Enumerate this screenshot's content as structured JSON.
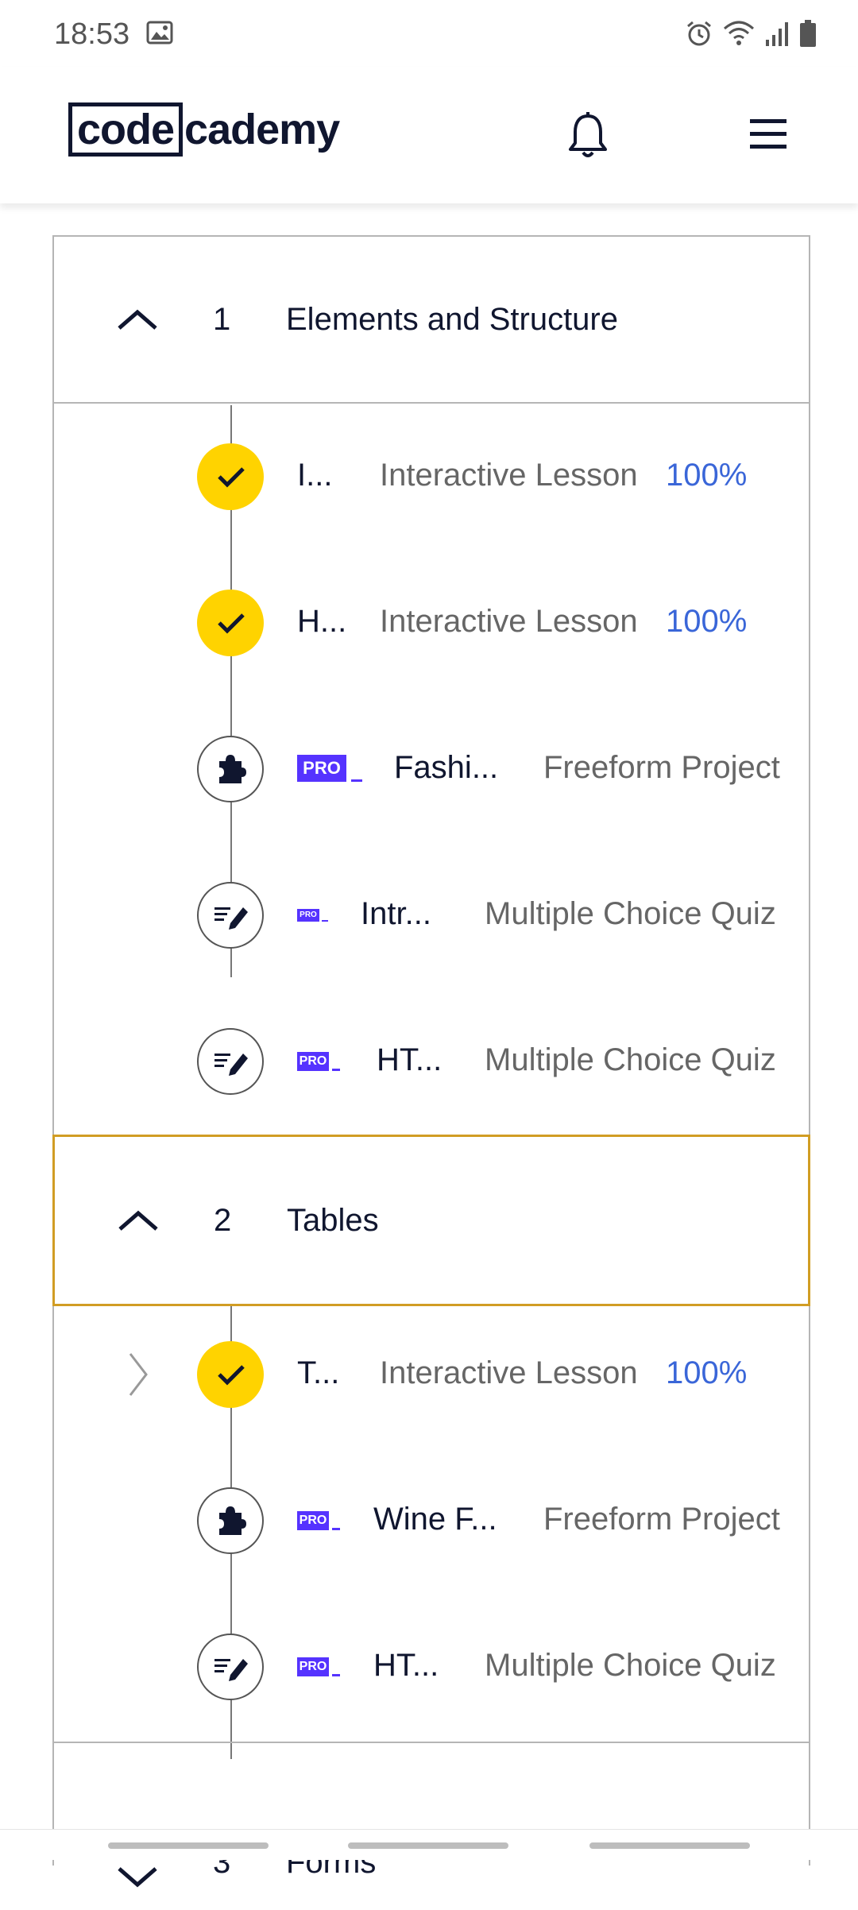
{
  "status_bar": {
    "time": "18:53"
  },
  "header": {
    "logo_boxed": "code",
    "logo_rest": "cademy"
  },
  "modules": [
    {
      "number": "1",
      "title": "Elements and Structure",
      "items": [
        {
          "title": "I...",
          "type": "Interactive Lesson",
          "progress": "100%",
          "done": true,
          "icon": "check-icon"
        },
        {
          "title": "H...",
          "type": "Interactive Lesson",
          "progress": "100%",
          "done": true,
          "icon": "check-icon"
        },
        {
          "title": "Fashi...",
          "type": "Freeform Project",
          "pro": "PRO",
          "icon": "puzzle-icon"
        },
        {
          "title": "Intr...",
          "type": "Multiple Choice Quiz",
          "pro": "PRO",
          "icon": "quiz-icon"
        },
        {
          "title": "HT...",
          "type": "Multiple Choice Quiz",
          "pro": "PRO",
          "icon": "quiz-icon"
        }
      ]
    },
    {
      "number": "2",
      "title": "Tables",
      "items": [
        {
          "title": "T...",
          "type": "Interactive Lesson",
          "progress": "100%",
          "done": true,
          "icon": "check-icon"
        },
        {
          "title": "Wine F...",
          "type": "Freeform Project",
          "pro": "PRO",
          "icon": "puzzle-icon"
        },
        {
          "title": "HT...",
          "type": "Multiple Choice Quiz",
          "pro": "PRO",
          "icon": "quiz-icon"
        }
      ]
    },
    {
      "number": "3",
      "title": "Forms"
    }
  ],
  "colors": {
    "accent_yellow": "#ffd300",
    "pro_purple": "#5533ff",
    "progress_blue": "#3a66d8",
    "active_border": "#d19d24"
  }
}
